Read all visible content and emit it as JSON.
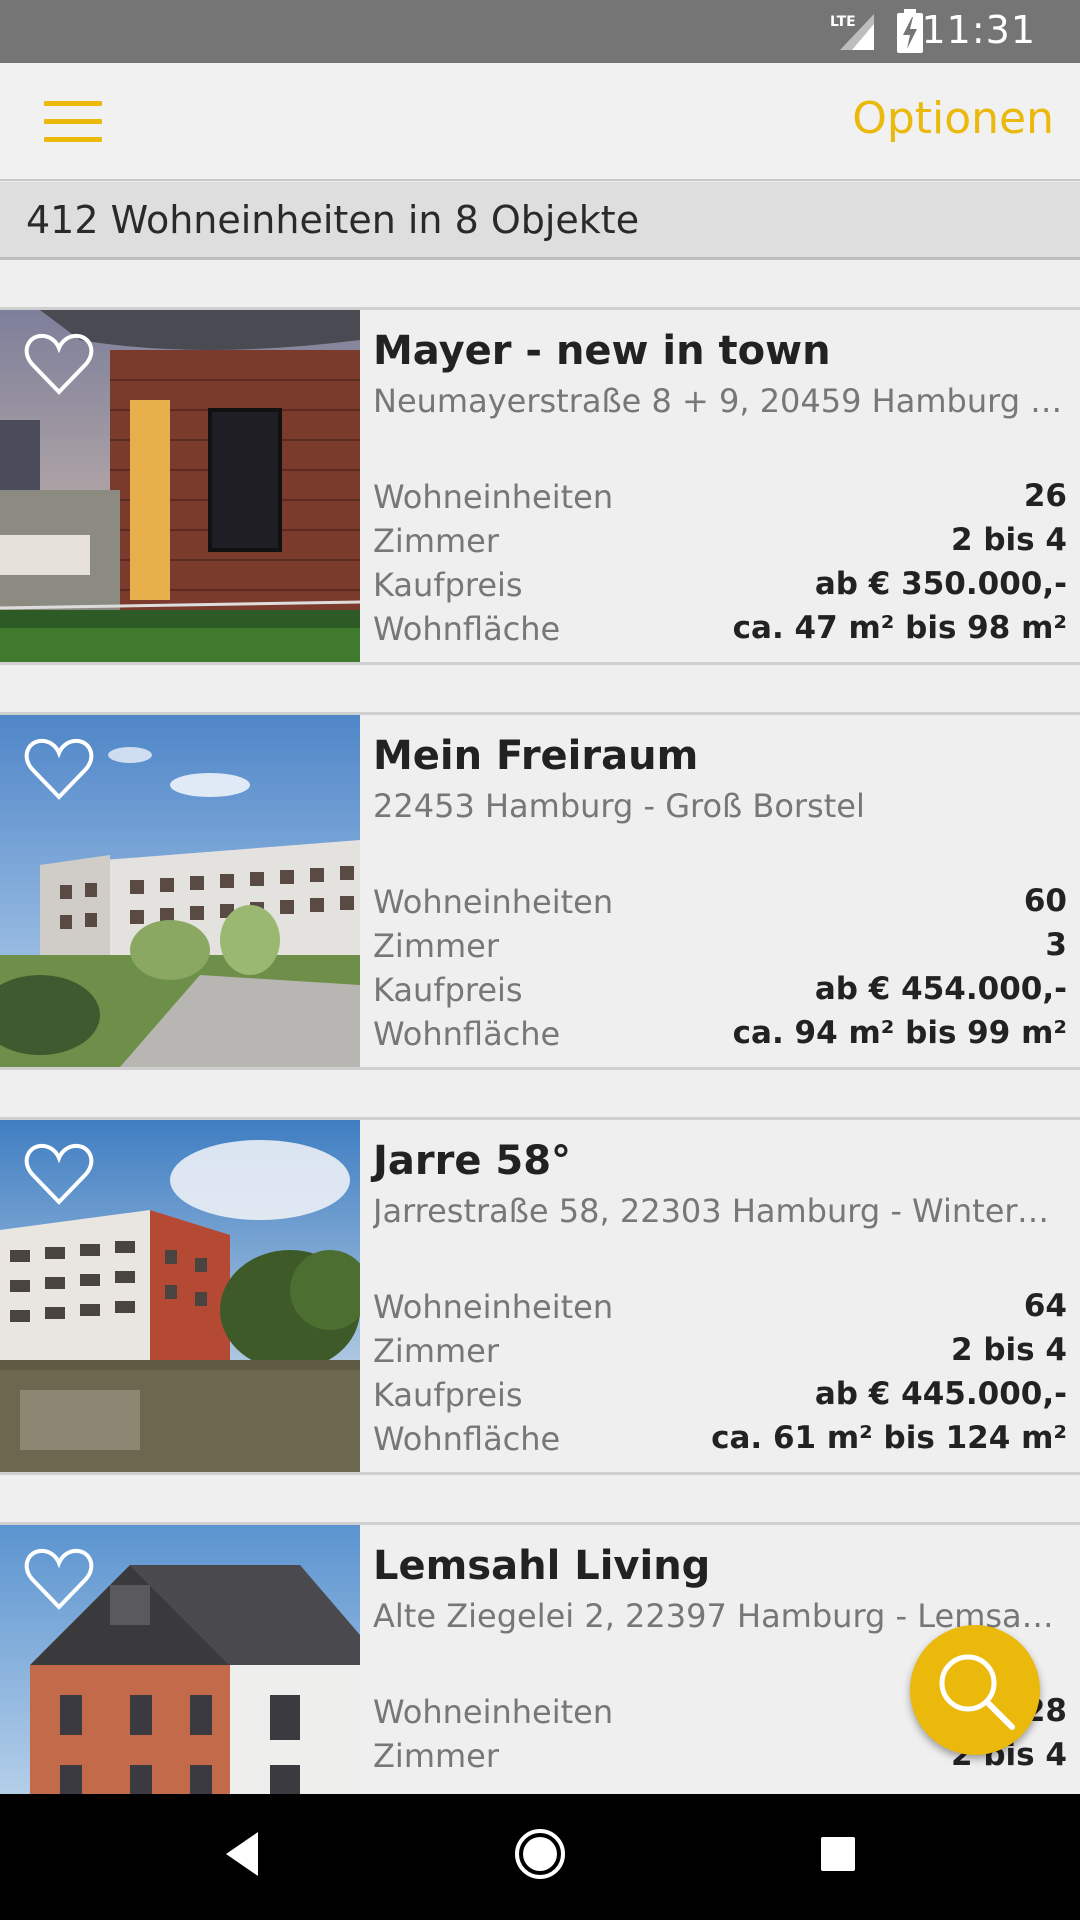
{
  "status_bar": {
    "network": "LTE",
    "time": "11:31"
  },
  "app_bar": {
    "options_label": "Optionen"
  },
  "summary": {
    "count_text": "412 Wohneinheiten in 8 Objekte"
  },
  "listings": [
    {
      "title": "Mayer - new in town",
      "address": "Neumayerstraße 8 + 9, 20459 Hamburg -...",
      "rows": [
        {
          "label": "Wohneinheiten",
          "value": "26"
        },
        {
          "label": "Zimmer",
          "value": "2 bis 4"
        },
        {
          "label": "Kaufpreis",
          "value": "ab € 350.000,-"
        },
        {
          "label": "Wohnfläche",
          "value": "ca. 47 m² bis 98 m²"
        }
      ]
    },
    {
      "title": "Mein Freiraum",
      "address": "22453 Hamburg - Groß Borstel",
      "rows": [
        {
          "label": "Wohneinheiten",
          "value": "60"
        },
        {
          "label": "Zimmer",
          "value": "3"
        },
        {
          "label": "Kaufpreis",
          "value": "ab € 454.000,-"
        },
        {
          "label": "Wohnfläche",
          "value": "ca. 94 m² bis 99 m²"
        }
      ]
    },
    {
      "title": "Jarre 58°",
      "address": "Jarrestraße 58, 22303 Hamburg - Winterh...",
      "rows": [
        {
          "label": "Wohneinheiten",
          "value": "64"
        },
        {
          "label": "Zimmer",
          "value": "2 bis 4"
        },
        {
          "label": "Kaufpreis",
          "value": "ab € 445.000,-"
        },
        {
          "label": "Wohnfläche",
          "value": "ca. 61 m² bis 124 m²"
        }
      ]
    },
    {
      "title": "Lemsahl Living",
      "address": "Alte Ziegelei 2, 22397 Hamburg - Lemsahl-...",
      "rows": [
        {
          "label": "Wohneinheiten",
          "value": "28"
        },
        {
          "label": "Zimmer",
          "value": "2 bis 4"
        }
      ]
    }
  ],
  "icons": {
    "menu": "hamburger-menu-icon",
    "favorite": "heart-outline-icon",
    "search": "search-icon",
    "back": "back-triangle-icon",
    "home": "home-circle-icon",
    "recents": "recents-square-icon"
  },
  "colors": {
    "accent": "#eab90c",
    "status_bar": "#757575",
    "background": "#efefef",
    "nav_bar": "#000000"
  }
}
